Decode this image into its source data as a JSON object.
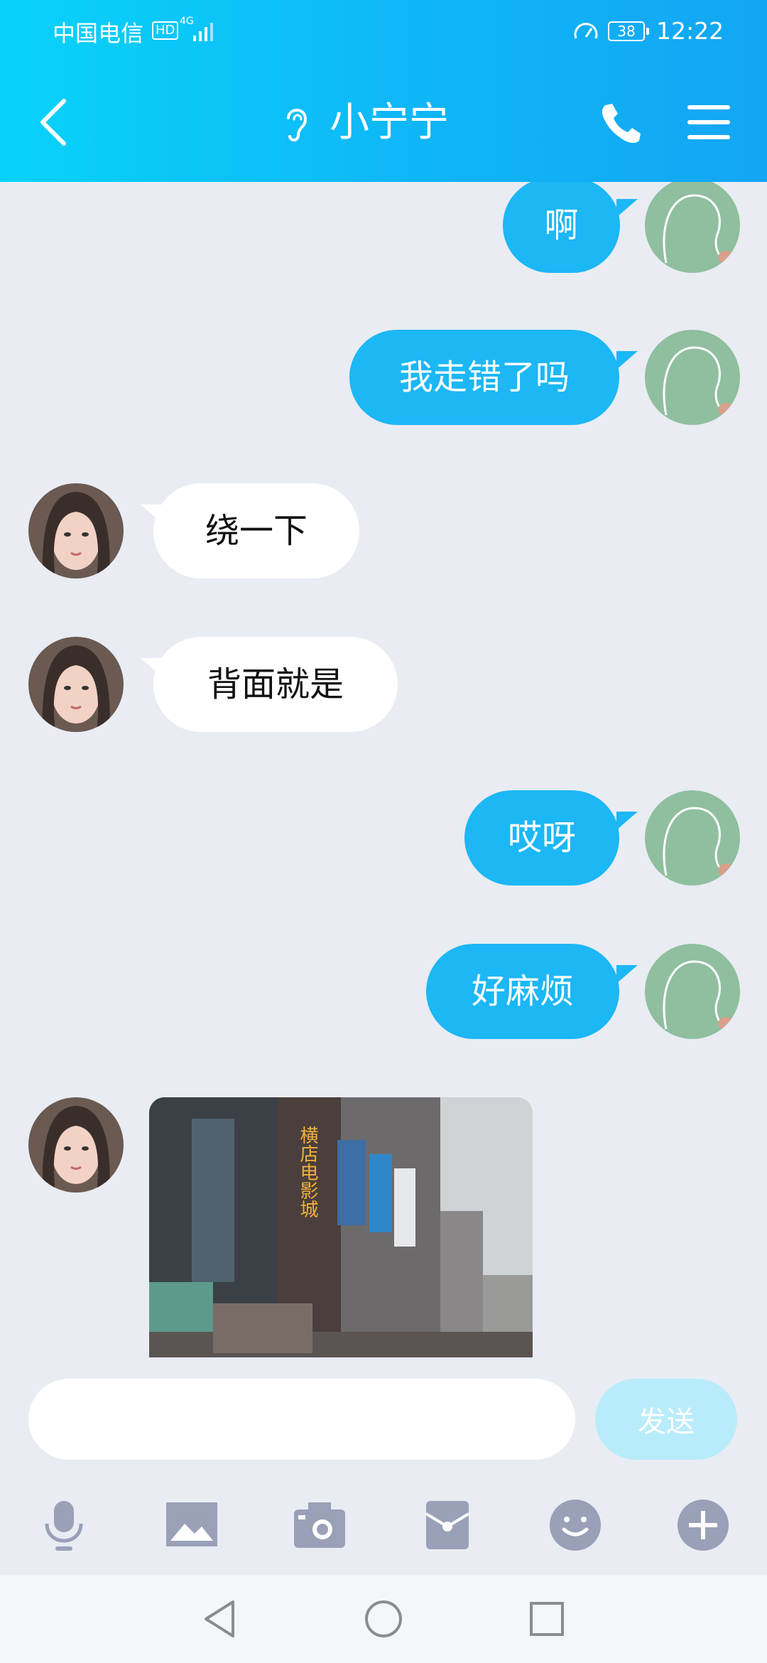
{
  "status_bar": {
    "carrier": "中国电信",
    "hd": "HD",
    "network": "4G",
    "battery": "38",
    "time": "12:22"
  },
  "header": {
    "title": "小宁宁"
  },
  "messages": [
    {
      "side": "out",
      "text": "啊"
    },
    {
      "side": "out",
      "text": "我走错了吗"
    },
    {
      "side": "in",
      "text": "绕一下"
    },
    {
      "side": "in",
      "text": "背面就是"
    },
    {
      "side": "out",
      "text": "哎呀"
    },
    {
      "side": "out",
      "text": "好麻烦"
    },
    {
      "side": "in",
      "type": "image",
      "sign_text": "横店电影城"
    }
  ],
  "composer": {
    "placeholder": "",
    "send_label": "发送"
  },
  "toolbar": {
    "icons": [
      "microphone-icon",
      "image-icon",
      "camera-icon",
      "red-packet-icon",
      "emoji-icon",
      "plus-icon"
    ]
  },
  "colors": {
    "header_start": "#08d3fb",
    "header_end": "#13a6f3",
    "outgoing_bubble": "#1cb7f5",
    "incoming_bubble": "#ffffff",
    "background": "#e9ecf3",
    "send_disabled": "#b9ecfb",
    "toolbar_icon": "#9aa0b8"
  }
}
